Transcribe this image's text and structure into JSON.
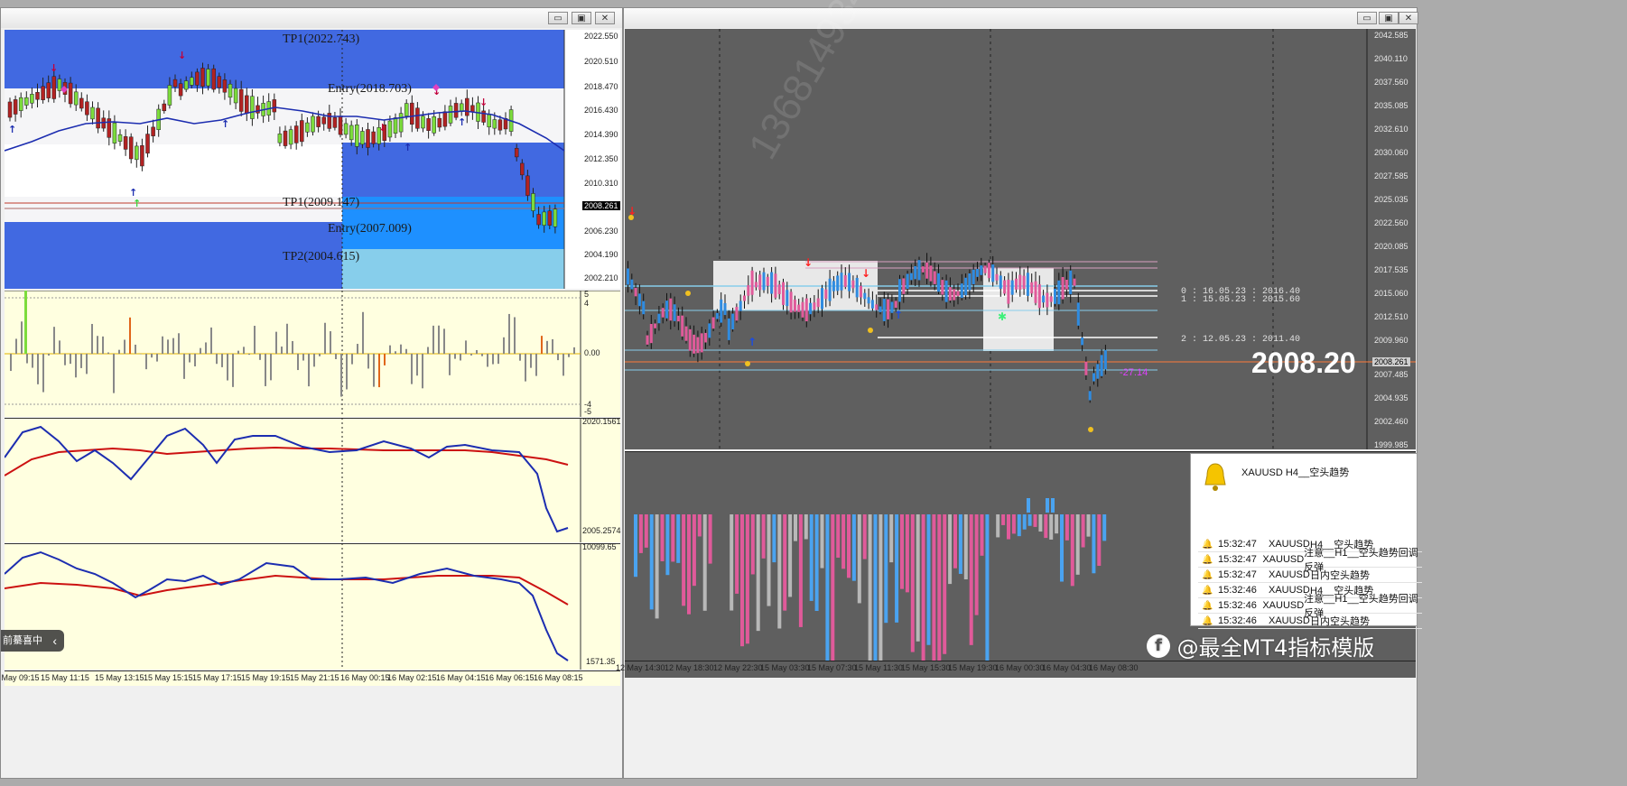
{
  "left_window": {
    "levels": {
      "tp1_upper": "TP1(2022.743)",
      "entry_upper": "Entry(2018.703)",
      "tp1_lower": "TP1(2009.147)",
      "entry_lower": "Entry(2007.009)",
      "tp2_lower": "TP2(2004.615)"
    },
    "price_axis": [
      "2022.550",
      "2020.510",
      "2018.470",
      "2016.430",
      "2014.390",
      "2012.350",
      "2010.310",
      "2008.261",
      "2006.230",
      "2004.190",
      "2002.210"
    ],
    "current_price": "2008.261",
    "sub1_axis": [
      "5",
      "4",
      "0.00",
      "-4",
      "-5"
    ],
    "sub2_axis": [
      "2020.1561",
      "2005.2574"
    ],
    "sub3_axis": [
      "10099.65",
      "1571.35"
    ],
    "time_axis": [
      "15 May 09:15",
      "15 May 11:15",
      "15 May 13:15",
      "15 May 15:15",
      "15 May 17:15",
      "15 May 19:15",
      "15 May 21:15",
      "16 May 00:15",
      "16 May 02:15",
      "16 May 04:15",
      "16 May 06:15",
      "16 May 08:15"
    ],
    "tooltip_text": "前驀喜中",
    "tooltip_arrow": "‹"
  },
  "right_window": {
    "price_axis": [
      "2042.585",
      "2040.110",
      "2037.560",
      "2035.085",
      "2032.610",
      "2030.060",
      "2027.585",
      "2025.035",
      "2022.560",
      "2020.085",
      "2017.535",
      "2015.060",
      "2012.510",
      "2009.960",
      "2007.485",
      "2004.935",
      "2002.460",
      "1999.985"
    ],
    "current_price_tag": "2008.261",
    "big_price": "2008.20",
    "fib_labels": [
      "0 : 16.05.23 : 2016.40",
      "1 : 15.05.23 : 2015.60",
      "2 : 12.05.23 : 2011.40"
    ],
    "pip_label": "-27.14",
    "time_axis": [
      "12 May 14:30",
      "12 May 18:30",
      "12 May 22:30",
      "15 May 03:30",
      "15 May 07:30",
      "15 May 11:30",
      "15 May 15:30",
      "15 May 19:30",
      "16 May 00:30",
      "16 May 04:30",
      "16 May 08:30"
    ]
  },
  "alert_popup": {
    "header": "XAUUSD  H4__空头趋势",
    "rows": [
      {
        "time": "15:32:47",
        "symbol": "XAUUSD",
        "message": "H4__空头趋势"
      },
      {
        "time": "15:32:47",
        "symbol": "XAUUSD",
        "message": "注意__H1__空头趋势回调反弹"
      },
      {
        "time": "15:32:47",
        "symbol": "XAUUSD",
        "message": "日内空头趋势"
      },
      {
        "time": "15:32:46",
        "symbol": "XAUUSD",
        "message": "H4__空头趋势"
      },
      {
        "time": "15:32:46",
        "symbol": "XAUUSD",
        "message": "注意__H1__空头趋势回调反弹"
      },
      {
        "time": "15:32:46",
        "symbol": "XAUUSD",
        "message": "日内空头趋势"
      }
    ]
  },
  "window_buttons": {
    "minimize": "▭",
    "restore": "▣",
    "close": "✕"
  },
  "watermark_phone": "13681493429",
  "brand_watermark": "@最全MT4指标模版",
  "colors": {
    "band_blue": "#4169e1",
    "band_cyan": "#1e90ff",
    "band_light": "#87ceeb",
    "dark_chart": "#5f5f5f",
    "pink_hist": "#e05a9a",
    "blue_hist": "#4aa3f0"
  }
}
